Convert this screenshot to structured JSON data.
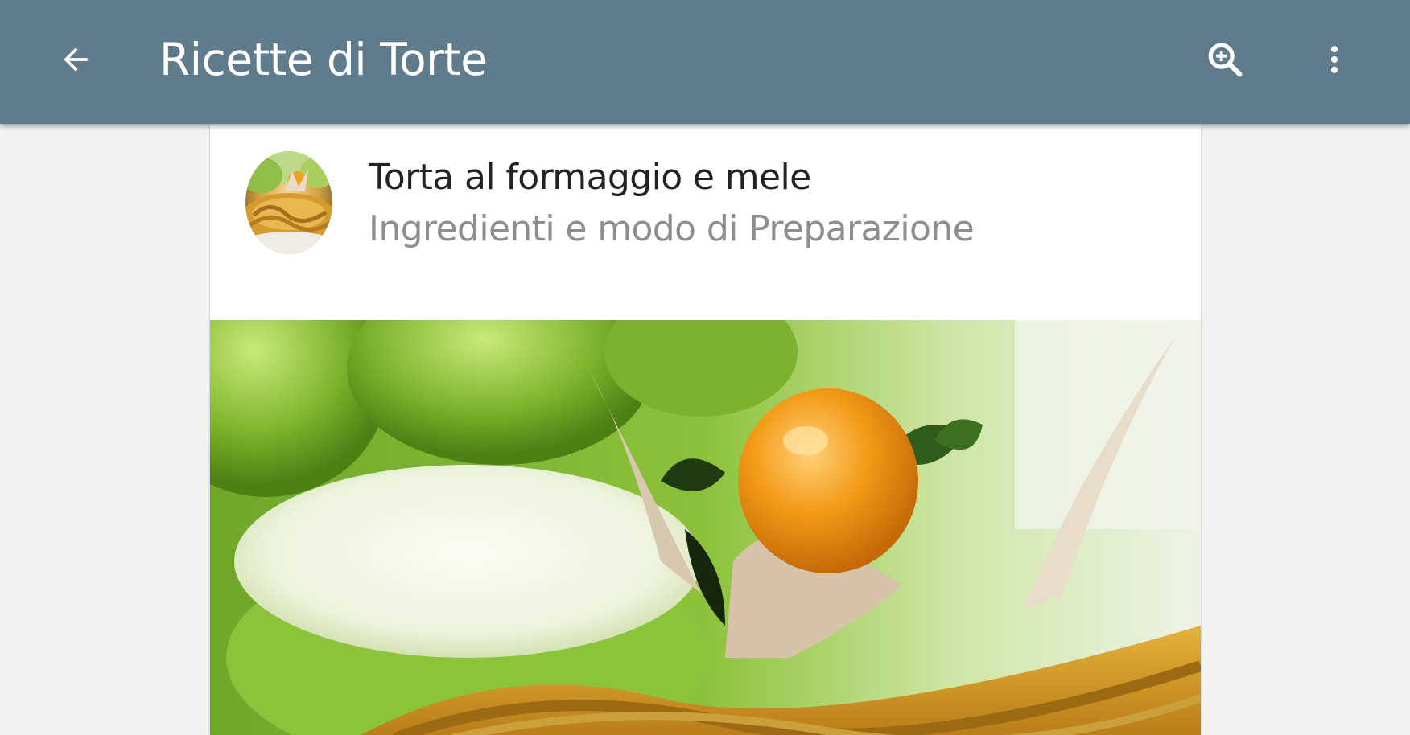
{
  "appbar": {
    "title": "Ricette di Torte",
    "background": "#5f7b8c",
    "icons": {
      "back": "arrow-back-icon",
      "search": "search-icon",
      "overflow": "more-vert-icon"
    }
  },
  "post": {
    "title": "Torta al formaggio e mele",
    "subtitle": "Ingredienti e modo di Preparazione",
    "avatar_icon": "recipe-thumbnail",
    "image": "cheese-and-apple-tart-photo"
  }
}
